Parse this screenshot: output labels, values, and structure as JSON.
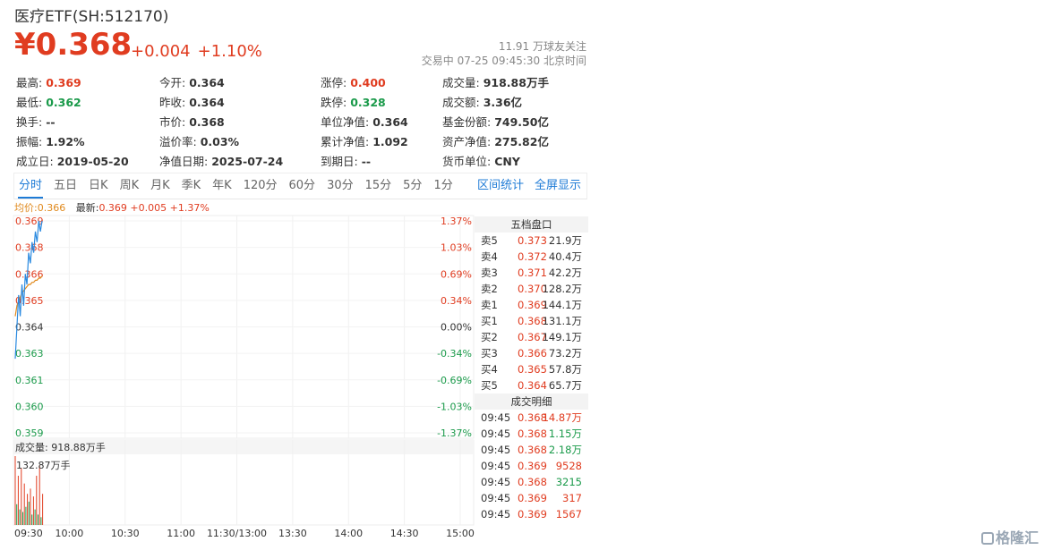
{
  "header": {
    "title": "医疗ETF(SH:512170)",
    "price": "¥0.368",
    "change_abs": "+0.004",
    "change_pct": "+1.10%",
    "followers": "11.91 万球友关注",
    "trade_status": "交易中 07-25 09:45:30 北京时间"
  },
  "stats": {
    "high_k": "最高:",
    "high_v": "0.369",
    "open_k": "今开:",
    "open_v": "0.364",
    "limit_up_k": "涨停:",
    "limit_up_v": "0.400",
    "volume_k": "成交量:",
    "volume_v": "918.88万手",
    "low_k": "最低:",
    "low_v": "0.362",
    "prev_close_k": "昨收:",
    "prev_close_v": "0.364",
    "limit_down_k": "跌停:",
    "limit_down_v": "0.328",
    "amount_k": "成交额:",
    "amount_v": "3.36亿",
    "turnover_k": "换手:",
    "turnover_v": "--",
    "mkt_price_k": "市价:",
    "mkt_price_v": "0.368",
    "nav_k": "单位净值:",
    "nav_v": "0.364",
    "fund_share_k": "基金份额:",
    "fund_share_v": "749.50亿",
    "amplitude_k": "振幅:",
    "amplitude_v": "1.92%",
    "premium_k": "溢价率:",
    "premium_v": "0.03%",
    "acc_nav_k": "累计净值:",
    "acc_nav_v": "1.092",
    "net_assets_k": "资产净值:",
    "net_assets_v": "275.82亿",
    "est_date_k": "成立日:",
    "est_date_v": "2019-05-20",
    "nav_date_k": "净值日期:",
    "nav_date_v": "2025-07-24",
    "expiry_k": "到期日:",
    "expiry_v": "--",
    "currency_k": "货币单位:",
    "currency_v": "CNY"
  },
  "tabs": [
    "分时",
    "五日",
    "日K",
    "周K",
    "月K",
    "季K",
    "年K",
    "120分",
    "60分",
    "30分",
    "15分",
    "5分",
    "1分"
  ],
  "tabs_right": [
    "区间统计",
    "全屏显示"
  ],
  "legend": {
    "avg_label": "均价:",
    "avg_value": "0.366",
    "new_label": "最新:",
    "new_value": "0.369 +0.005 +1.37%"
  },
  "volume_label": "成交量: 918.88万手",
  "volume_peak_label": "132.87万手",
  "order_book": {
    "title": "五档盘口",
    "rows": [
      {
        "label": "卖5",
        "price": "0.373",
        "vol": "21.9万"
      },
      {
        "label": "卖4",
        "price": "0.372",
        "vol": "40.4万"
      },
      {
        "label": "卖3",
        "price": "0.371",
        "vol": "42.2万"
      },
      {
        "label": "卖2",
        "price": "0.370",
        "vol": "128.2万"
      },
      {
        "label": "卖1",
        "price": "0.369",
        "vol": "144.1万"
      },
      {
        "label": "买1",
        "price": "0.368",
        "vol": "131.1万"
      },
      {
        "label": "买2",
        "price": "0.367",
        "vol": "149.1万"
      },
      {
        "label": "买3",
        "price": "0.366",
        "vol": "73.2万"
      },
      {
        "label": "买4",
        "price": "0.365",
        "vol": "57.8万"
      },
      {
        "label": "买5",
        "price": "0.364",
        "vol": "65.7万"
      }
    ]
  },
  "trades": {
    "title": "成交明细",
    "rows": [
      {
        "time": "09:45",
        "price": "0.368",
        "vol": "14.87万",
        "side": "sell"
      },
      {
        "time": "09:45",
        "price": "0.368",
        "vol": "1.15万",
        "side": "buy"
      },
      {
        "time": "09:45",
        "price": "0.368",
        "vol": "2.18万",
        "side": "buy"
      },
      {
        "time": "09:45",
        "price": "0.369",
        "vol": "9528",
        "side": "sell"
      },
      {
        "time": "09:45",
        "price": "0.368",
        "vol": "3215",
        "side": "buy"
      },
      {
        "time": "09:45",
        "price": "0.369",
        "vol": "317",
        "side": "sell"
      },
      {
        "time": "09:45",
        "price": "0.369",
        "vol": "1567",
        "side": "sell"
      }
    ]
  },
  "logo_text": "格隆汇",
  "colors": {
    "up": "#e03c20",
    "down": "#1a9a4a",
    "accent": "#1e7bd6",
    "avg_line": "#e08a1e",
    "price_line": "#2a8ae0"
  },
  "chart_data": {
    "type": "line",
    "y_ticks_left": [
      "0.369",
      "0.368",
      "0.366",
      "0.365",
      "0.364",
      "0.363",
      "0.361",
      "0.360",
      "0.359"
    ],
    "y_ticks_right": [
      "1.37%",
      "1.03%",
      "0.69%",
      "0.34%",
      "0.00%",
      "-0.34%",
      "-0.69%",
      "-1.03%",
      "-1.37%"
    ],
    "x_ticks": [
      "09:30",
      "10:00",
      "10:30",
      "11:00",
      "11:30/13:00",
      "13:30",
      "14:00",
      "14:30",
      "15:00"
    ],
    "ylim": [
      0.359,
      0.369
    ],
    "series": [
      {
        "name": "最新",
        "values": [
          0.3625,
          0.364,
          0.3655,
          0.3645,
          0.366,
          0.365,
          0.3665,
          0.366,
          0.3675,
          0.367,
          0.368,
          0.3675,
          0.3685,
          0.368,
          0.369,
          0.3685,
          0.369
        ]
      },
      {
        "name": "均价",
        "values": [
          0.3645,
          0.365,
          0.3652,
          0.3654,
          0.3656,
          0.3657,
          0.3658,
          0.3659,
          0.366,
          0.366,
          0.3661,
          0.3661,
          0.3662,
          0.3662,
          0.3663,
          0.3663,
          0.3664
        ]
      }
    ],
    "volume_values": [
      132.87,
      40,
      95,
      30,
      110,
      25,
      80,
      35,
      60,
      45,
      70,
      20,
      55,
      30,
      95,
      20,
      115,
      15,
      60
    ],
    "volume_up": [
      true,
      false,
      true,
      false,
      true,
      false,
      true,
      false,
      true,
      false,
      true,
      false,
      true,
      false,
      true,
      false,
      true,
      false,
      true
    ]
  }
}
